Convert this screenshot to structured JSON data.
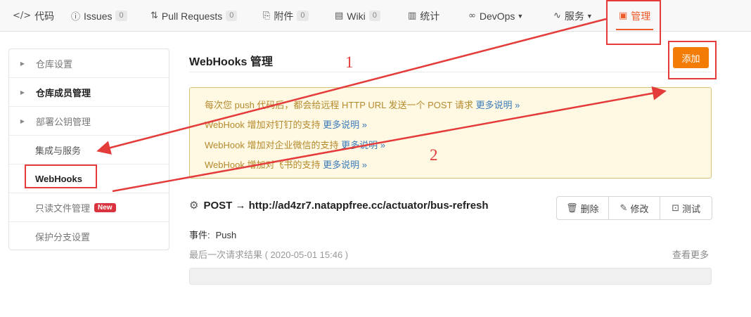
{
  "topnav": {
    "tabs": [
      {
        "icon": "code-icon",
        "glyph": "</>",
        "label": "代码",
        "count": null,
        "caret": false
      },
      {
        "icon": "issues-icon",
        "glyph": "ⓘ",
        "label": "Issues",
        "count": "0",
        "caret": false
      },
      {
        "icon": "pull-request-icon",
        "glyph": "⇅",
        "label": "Pull Requests",
        "count": "0",
        "caret": false
      },
      {
        "icon": "attachment-icon",
        "glyph": "⎘",
        "label": "附件",
        "count": "0",
        "caret": false
      },
      {
        "icon": "wiki-icon",
        "glyph": "▤",
        "label": "Wiki",
        "count": "0",
        "caret": false
      },
      {
        "icon": "stats-icon",
        "glyph": "▥",
        "label": "统计",
        "count": null,
        "caret": false
      },
      {
        "icon": "devops-icon",
        "glyph": "∞",
        "label": "DevOps",
        "count": null,
        "caret": true
      },
      {
        "icon": "service-icon",
        "glyph": "∿",
        "label": "服务",
        "count": null,
        "caret": true
      },
      {
        "icon": "manage-icon",
        "glyph": "▣",
        "label": "管理",
        "count": null,
        "caret": false
      }
    ],
    "active_tab": "管理"
  },
  "sidebar": {
    "items": [
      {
        "label": "仓库设置",
        "arrow": true
      },
      {
        "label": "仓库成员管理",
        "arrow": true
      },
      {
        "label": "部署公钥管理",
        "arrow": true
      },
      {
        "label": "集成与服务",
        "arrow": false
      },
      {
        "label": "WebHooks",
        "arrow": false
      },
      {
        "label": "只读文件管理",
        "arrow": false,
        "badge": "New"
      },
      {
        "label": "保护分支设置",
        "arrow": false
      }
    ]
  },
  "main": {
    "title": "WebHooks 管理",
    "add_label": "添加",
    "notice": [
      {
        "text": "每次您 push 代码后，都会给远程 HTTP URL 发送一个 POST 请求",
        "more": "更多说明 »"
      },
      {
        "text": "WebHook 增加对钉钉的支持",
        "more": "更多说明 »"
      },
      {
        "text": "WebHook 增加对企业微信的支持",
        "more": "更多说明 »"
      },
      {
        "text": "WebHook 增加对飞书的支持",
        "more": "更多说明 »"
      }
    ],
    "hook": {
      "title": "POST → http://ad4zr7.natappfree.cc/actuator/bus-refresh",
      "delete_label": "删除",
      "edit_label": "修改",
      "test_label": "测试",
      "event_label": "事件:",
      "event_value": "Push",
      "last_request": "最后一次请求结果 ( 2020-05-01 15:46 )",
      "view_more": "查看更多"
    }
  },
  "annotations": {
    "num1": "1",
    "num2": "2",
    "color": "#e43b3b"
  },
  "colors": {
    "accent": "#f05a28",
    "add_button": "#f27c06",
    "notice_bg": "#fff9e4",
    "notice_text": "#b58a2c",
    "link": "#3a7ab8"
  }
}
